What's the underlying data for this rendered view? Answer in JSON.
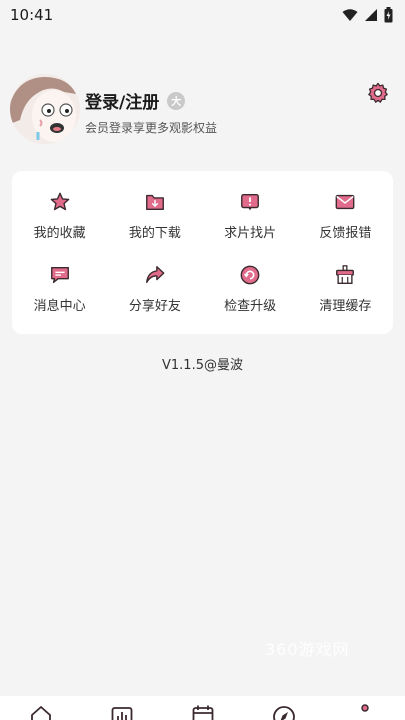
{
  "status_bar": {
    "time": "10:41",
    "icons": [
      "wifi-icon",
      "signal-icon",
      "battery-icon"
    ]
  },
  "profile": {
    "title": "登录/注册",
    "badge": "大",
    "subtitle": "会员登录享更多观影权益",
    "avatar_icon": "cartoon-avatar",
    "settings_icon": "gear-icon"
  },
  "menu": {
    "items": [
      {
        "label": "我的收藏",
        "icon": "star-icon"
      },
      {
        "label": "我的下载",
        "icon": "download-folder-icon"
      },
      {
        "label": "求片找片",
        "icon": "request-icon"
      },
      {
        "label": "反馈报错",
        "icon": "mail-icon"
      },
      {
        "label": "消息中心",
        "icon": "message-icon"
      },
      {
        "label": "分享好友",
        "icon": "share-icon"
      },
      {
        "label": "检查升级",
        "icon": "upgrade-icon"
      },
      {
        "label": "清理缓存",
        "icon": "clean-icon"
      }
    ]
  },
  "version": "V1.1.5@曼波",
  "watermark": "360游戏网",
  "bottom_nav": {
    "items": [
      "home-icon",
      "chart-icon",
      "calendar-icon",
      "compass-icon",
      "profile-icon"
    ]
  },
  "colors": {
    "accent": "#e06b8b",
    "icon_outline": "#3a2a2e",
    "background": "#f5f4f4",
    "card": "#ffffff"
  }
}
